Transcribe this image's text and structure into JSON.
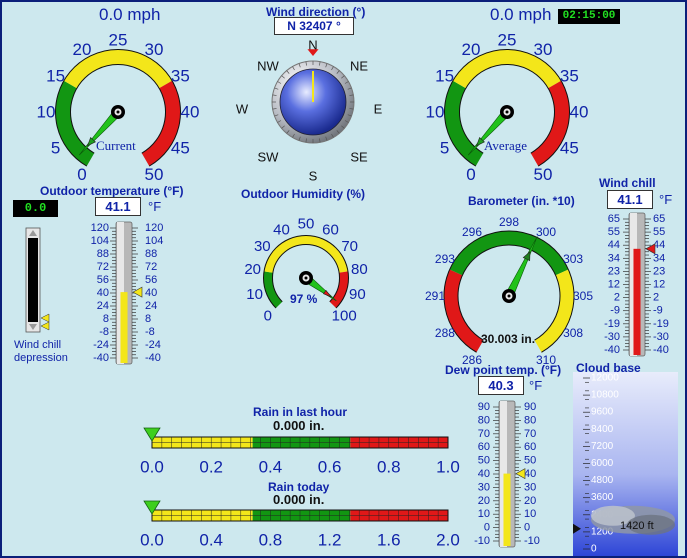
{
  "clock": "02:15:00",
  "wind_current": {
    "speed_text": "0.0 mph",
    "label": "Current",
    "ticks": [
      "0",
      "5",
      "10",
      "15",
      "20",
      "25",
      "30",
      "35",
      "40",
      "45",
      "50"
    ],
    "value": 2
  },
  "wind_average": {
    "speed_text": "0.0 mph",
    "label": "Average",
    "ticks": [
      "0",
      "5",
      "10",
      "15",
      "20",
      "25",
      "30",
      "35",
      "40",
      "45",
      "50"
    ],
    "value": 2
  },
  "wind_direction": {
    "title": "Wind direction (°)",
    "readout": "N  32407 °",
    "compass": [
      "N",
      "NE",
      "E",
      "SE",
      "S",
      "SW",
      "W",
      "NW"
    ],
    "value": 0
  },
  "outdoor_temp": {
    "title": "Outdoor temperature (°F)",
    "value_text": "41.1",
    "unit": "°F",
    "ticks": [
      "120",
      "104",
      "88",
      "72",
      "56",
      "40",
      "24",
      "8",
      "-8",
      "-24",
      "-40"
    ],
    "value": 41.1
  },
  "wind_chill_depression": {
    "led": "0.0",
    "label_line1": "Wind chill",
    "label_line2": "depression"
  },
  "humidity": {
    "title": "Outdoor Humidity (%)",
    "ticks": [
      "0",
      "10",
      "20",
      "30",
      "40",
      "50",
      "60",
      "70",
      "80",
      "90",
      "100"
    ],
    "readout": "97 %",
    "value": 97
  },
  "barometer": {
    "title": "Barometer (in. *10)",
    "ticks": [
      "286",
      "288",
      "291",
      "293",
      "296",
      "298",
      "300",
      "303",
      "305",
      "308",
      "310"
    ],
    "readout": "30.003 in.",
    "value": 300.03
  },
  "wind_chill": {
    "title": "Wind chill",
    "value_text": "41.1",
    "unit": "°F",
    "ticks": [
      "65",
      "55",
      "44",
      "34",
      "23",
      "12",
      "2",
      "-9",
      "-19",
      "-30",
      "-40"
    ],
    "value": 41.1
  },
  "dew_point": {
    "title": "Dew point temp. (°F)",
    "value_text": "40.3",
    "unit": "°F",
    "ticks": [
      "90",
      "80",
      "70",
      "60",
      "50",
      "40",
      "30",
      "20",
      "10",
      "0",
      "-10"
    ],
    "value": 40.3
  },
  "cloud_base": {
    "title": "Cloud base",
    "ticks": [
      "12000",
      "10800",
      "9600",
      "8400",
      "7200",
      "6000",
      "4800",
      "3600",
      "2400",
      "1200",
      "0"
    ],
    "readout": "1420 ft",
    "value": 1420
  },
  "rain_hour": {
    "title": "Rain in last hour",
    "value_text": "0.000 in.",
    "ticks": [
      "0.0",
      "0.2",
      "0.4",
      "0.6",
      "0.8",
      "1.0"
    ],
    "value": 0
  },
  "rain_today": {
    "title": "Rain today",
    "value_text": "0.000 in.",
    "ticks": [
      "0.0",
      "0.4",
      "0.8",
      "1.2",
      "1.6",
      "2.0"
    ],
    "value": 0
  }
}
